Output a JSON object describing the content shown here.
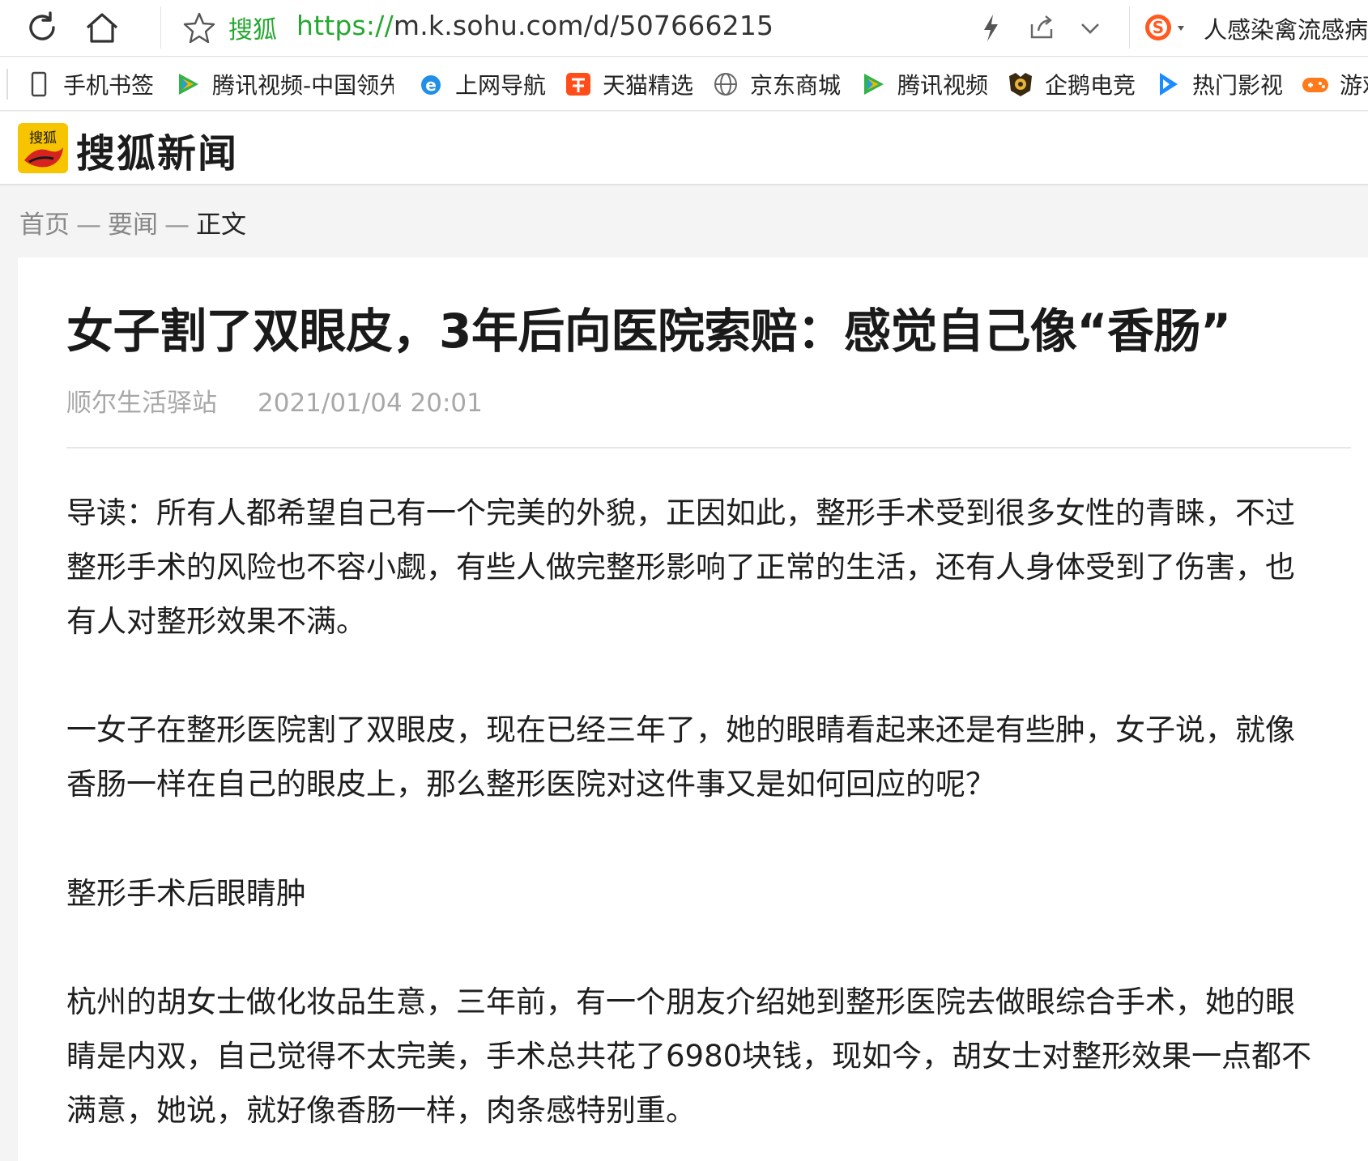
{
  "browser": {
    "site_name": "搜狐",
    "url_scheme": "https://",
    "url_rest": "m.k.sohu.com/d/507666215",
    "search_hint": "人感染禽流感病"
  },
  "bookmarks": [
    {
      "label": "手机书签",
      "icon": "phone-icon"
    },
    {
      "label": "腾讯视频-中国领先",
      "icon": "tencent-video-icon"
    },
    {
      "label": "上网导航",
      "icon": "ie-icon"
    },
    {
      "label": "天猫精选",
      "icon": "tmall-icon"
    },
    {
      "label": "京东商城",
      "icon": "globe-icon"
    },
    {
      "label": "腾讯视频",
      "icon": "tencent-video-icon"
    },
    {
      "label": "企鹅电竞",
      "icon": "penguin-esports-icon"
    },
    {
      "label": "热门影视",
      "icon": "play-icon"
    },
    {
      "label": "游戏",
      "icon": "gamepad-icon"
    }
  ],
  "site": {
    "logo_glyphs": "搜狐",
    "logo_text": "搜狐新闻"
  },
  "breadcrumb": {
    "home": "首页",
    "sep": "—",
    "section": "要闻",
    "current": "正文"
  },
  "article": {
    "title": "女子割了双眼皮，3年后向医院索赔：感觉自己像“香肠”",
    "source": "顺尔生活驿站",
    "date": "2021/01/04 20:01",
    "paragraphs": [
      [
        "导读：所有人都希望自己有一个完美的外貌，正因如此，整形手术受到很多女性的青睐，不过",
        "整形手术的风险也不容小觑，有些人做完整形影响了正常的生活，还有人身体受到了伤害，也",
        "有人对整形效果不满。"
      ],
      [
        "一女子在整形医院割了双眼皮，现在已经三年了，她的眼睛看起来还是有些肿，女子说，就像",
        "香肠一样在自己的眼皮上，那么整形医院对这件事又是如何回应的呢？"
      ],
      [
        "整形手术后眼睛肿"
      ],
      [
        "杭州的胡女士做化妆品生意，三年前，有一个朋友介绍她到整形医院去做眼综合手术，她的眼",
        "睛是内双，自己觉得不太完美，手术总共花了6980块钱，现如今，胡女士对整形效果一点都不",
        "满意，她说，就好像香肠一样，肉条感特别重。"
      ]
    ]
  }
}
